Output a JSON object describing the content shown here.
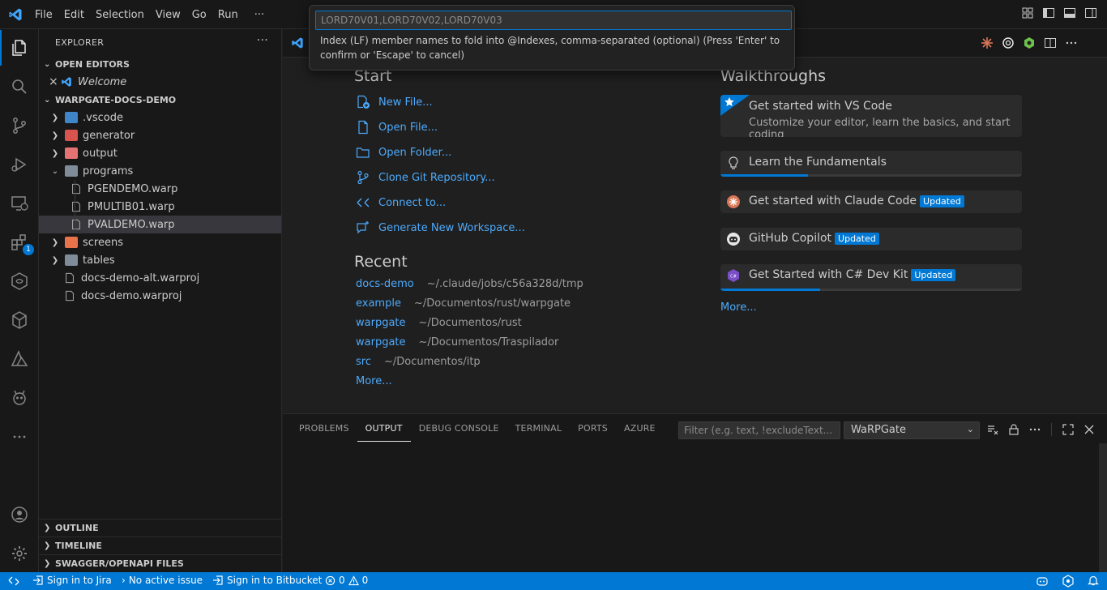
{
  "menu": [
    "File",
    "Edit",
    "Selection",
    "View",
    "Go",
    "Run",
    "···"
  ],
  "quick_input": {
    "placeholder": "LORD70V01,LORD70V02,LORD70V03",
    "message": "Index (LF) member names to fold into @Indexes, comma-separated (optional) (Press 'Enter' to confirm or 'Escape' to cancel)"
  },
  "activity_bar": {
    "extensions_badge": "1"
  },
  "explorer": {
    "title": "EXPLORER",
    "more": "···",
    "open_editors_header": "OPEN EDITORS",
    "open_editors": [
      {
        "label": "Welcome"
      }
    ],
    "workspace_header": "WARPGATE-DOCS-DEMO",
    "tree": [
      {
        "label": ".vscode",
        "type": "folder"
      },
      {
        "label": "generator",
        "type": "folder"
      },
      {
        "label": "output",
        "type": "folder"
      },
      {
        "label": "programs",
        "type": "folder-open"
      },
      {
        "label": "PGENDEMO.warp",
        "type": "file"
      },
      {
        "label": "PMULTIB01.warp",
        "type": "file"
      },
      {
        "label": "PVALDEMO.warp",
        "type": "file"
      },
      {
        "label": "screens",
        "type": "folder"
      },
      {
        "label": "tables",
        "type": "folder"
      },
      {
        "label": "docs-demo-alt.warproj",
        "type": "file"
      },
      {
        "label": "docs-demo.warproj",
        "type": "file"
      }
    ],
    "bottom_sections": [
      "OUTLINE",
      "TIMELINE",
      "SWAGGER/OPENAPI FILES"
    ]
  },
  "welcome": {
    "start_heading": "Start",
    "start_items": [
      {
        "label": "New File..."
      },
      {
        "label": "Open File..."
      },
      {
        "label": "Open Folder..."
      },
      {
        "label": "Clone Git Repository..."
      },
      {
        "label": "Connect to..."
      },
      {
        "label": "Generate New Workspace..."
      }
    ],
    "recent_heading": "Recent",
    "recent": [
      {
        "name": "docs-demo",
        "path": "~/.claude/jobs/c56a328d/tmp"
      },
      {
        "name": "example",
        "path": "~/Documentos/rust/warpgate"
      },
      {
        "name": "warpgate",
        "path": "~/Documentos/rust"
      },
      {
        "name": "warpgate",
        "path": "~/Documentos/Traspilador"
      },
      {
        "name": "src",
        "path": "~/Documentos/itp"
      }
    ],
    "recent_more": "More...",
    "walkthroughs_heading": "Walkthroughs",
    "walkthroughs": [
      {
        "title": "Get started with VS Code",
        "description": "Customize your editor, learn the basics, and start coding"
      },
      {
        "title": "Learn the Fundamentals",
        "progress": 0.29
      },
      {
        "title": "Get started with Claude Code",
        "badge": "Updated"
      },
      {
        "title": "GitHub Copilot",
        "badge": "Updated"
      },
      {
        "title": "Get Started with C# Dev Kit",
        "badge": "Updated",
        "progress": 0.33
      }
    ],
    "walkthroughs_more": "More..."
  },
  "panel": {
    "tabs": [
      "PROBLEMS",
      "OUTPUT",
      "DEBUG CONSOLE",
      "TERMINAL",
      "PORTS",
      "AZURE"
    ],
    "active_tab": "OUTPUT",
    "filter_placeholder": "Filter (e.g. text, !excludeText...",
    "output_channel": "WaRPGate"
  },
  "status_bar": {
    "jira": "Sign in to Jira",
    "issue": "No active issue",
    "bitbucket": "Sign in to Bitbucket",
    "errors": "0",
    "warnings": "0"
  },
  "colors": {
    "accent": "#0078d4",
    "link": "#4daafc",
    "background": "#1f1f1f",
    "sidebar": "#181818"
  }
}
